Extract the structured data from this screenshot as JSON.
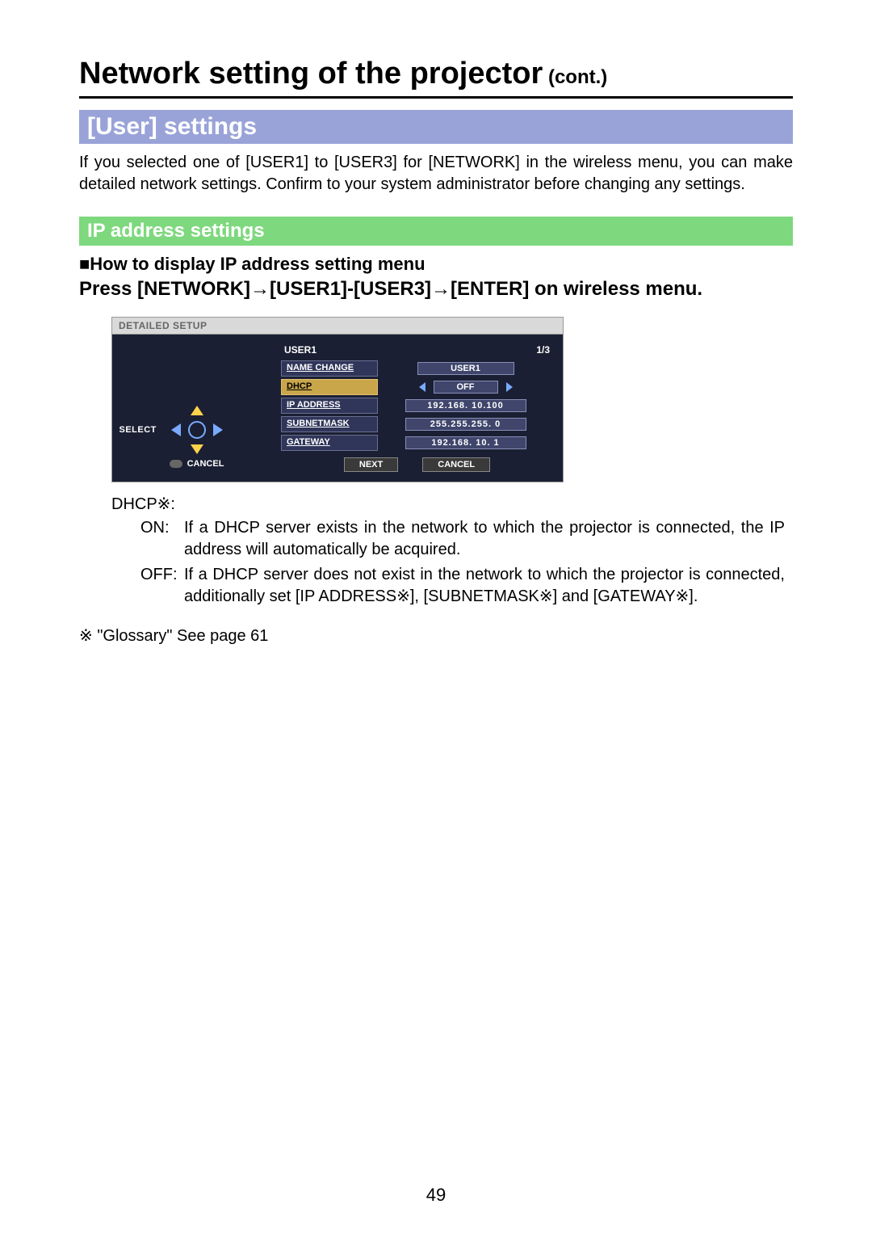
{
  "title": {
    "main": "Network setting of the projector",
    "cont": " (cont.)"
  },
  "section_user": "[User] settings",
  "intro": "If you selected one of [USER1] to [USER3] for [NETWORK] in the wireless menu, you can make detailed network settings. Confirm to your system administrator before changing any settings.",
  "section_ip": "IP address settings",
  "subhead": "■How to display IP address setting menu",
  "pressline": "Press [NETWORK]→[USER1]-[USER3]→[ENTER] on wireless menu.",
  "osd": {
    "panel_title": "DETAILED SETUP",
    "header_user": "USER1",
    "header_page": "1/3",
    "rows": {
      "name_change": {
        "label": "NAME CHANGE",
        "value": "USER1"
      },
      "dhcp": {
        "label": "DHCP",
        "value": "OFF"
      },
      "ip": {
        "label": "IP ADDRESS",
        "value": "192.168.  10.100"
      },
      "subnet": {
        "label": "SUBNETMASK",
        "value": "255.255.255.   0"
      },
      "gateway": {
        "label": "GATEWAY",
        "value": "192.168.  10.   1"
      }
    },
    "select_label": "SELECT",
    "cancel_label": "CANCEL",
    "btn_next": "NEXT",
    "btn_cancel": "CANCEL"
  },
  "dhcp_desc": {
    "title": "DHCP※:",
    "on_key": "ON:",
    "on_val": "If a DHCP server exists in the network to which the projector is connected, the IP address will automatically be acquired.",
    "off_key": "OFF:",
    "off_val": "If a DHCP server does not exist in the network to which the projector is connected, additionally set [IP ADDRESS※], [SUBNETMASK※] and [GATEWAY※]."
  },
  "glossary": "※ \"Glossary\" See page 61",
  "page_num": "49"
}
